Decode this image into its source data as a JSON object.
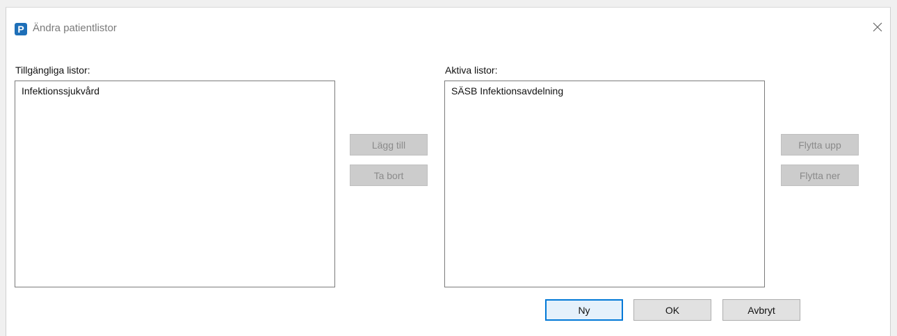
{
  "window": {
    "app_icon_letter": "P",
    "title": "Ändra patientlistor"
  },
  "available": {
    "label": "Tillgängliga listor:",
    "items": [
      "Infektionssjukvård"
    ]
  },
  "active": {
    "label": "Aktiva listor:",
    "items": [
      "SÄSB Infektionsavdelning"
    ]
  },
  "buttons": {
    "add": "Lägg till",
    "remove": "Ta bort",
    "move_up": "Flytta upp",
    "move_down": "Flytta ner",
    "new": "Ny",
    "ok": "OK",
    "cancel": "Avbryt"
  },
  "colors": {
    "accent": "#0078d7",
    "app_icon": "#1e6fb8",
    "disabled_button": "#cccccc"
  },
  "icons": {
    "app": "p-app-icon",
    "close": "close-icon"
  }
}
